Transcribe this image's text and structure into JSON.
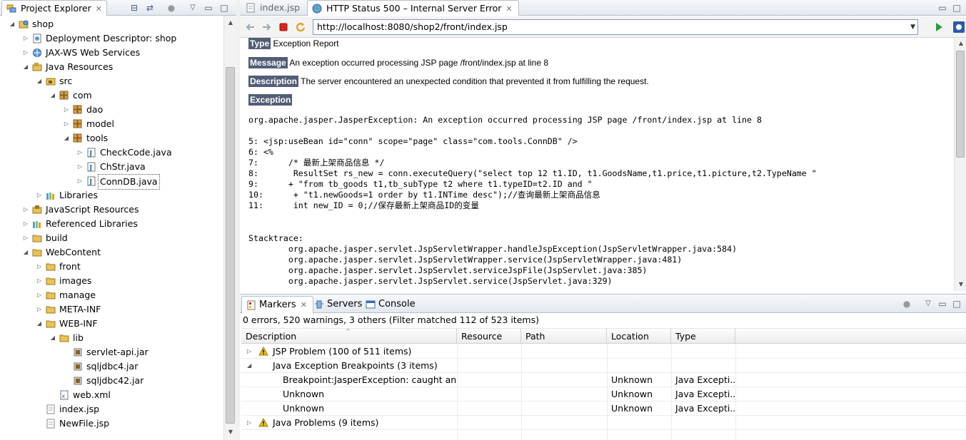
{
  "explorer": {
    "tab_label": "Project Explorer",
    "tree": [
      {
        "label": "shop",
        "icon": "project-icon",
        "depth": 0,
        "expanded": true
      },
      {
        "label": "Deployment Descriptor: shop",
        "icon": "deployment-descriptor-icon",
        "depth": 1,
        "expanded": false
      },
      {
        "label": "JAX-WS Web Services",
        "icon": "web-services-icon",
        "depth": 1,
        "expanded": false
      },
      {
        "label": "Java Resources",
        "icon": "java-resources-icon",
        "depth": 1,
        "expanded": true
      },
      {
        "label": "src",
        "icon": "source-folder-icon",
        "depth": 2,
        "expanded": true
      },
      {
        "label": "com",
        "icon": "package-icon",
        "depth": 3,
        "expanded": true
      },
      {
        "label": "dao",
        "icon": "package-icon",
        "depth": 4,
        "expanded": false
      },
      {
        "label": "model",
        "icon": "package-icon",
        "depth": 4,
        "expanded": false
      },
      {
        "label": "tools",
        "icon": "package-icon",
        "depth": 4,
        "expanded": true
      },
      {
        "label": "CheckCode.java",
        "icon": "java-file-icon",
        "depth": 5,
        "expanded": false
      },
      {
        "label": "ChStr.java",
        "icon": "java-file-icon",
        "depth": 5,
        "expanded": false
      },
      {
        "label": "ConnDB.java",
        "icon": "java-file-icon",
        "depth": 5,
        "expanded": false,
        "selected": true
      },
      {
        "label": "Libraries",
        "icon": "library-icon",
        "depth": 2,
        "expanded": false
      },
      {
        "label": "JavaScript Resources",
        "icon": "javascript-resources-icon",
        "depth": 1,
        "expanded": false
      },
      {
        "label": "Referenced Libraries",
        "icon": "library-icon",
        "depth": 1,
        "expanded": false
      },
      {
        "label": "build",
        "icon": "folder-icon",
        "depth": 1,
        "expanded": false
      },
      {
        "label": "WebContent",
        "icon": "folder-icon",
        "depth": 1,
        "expanded": true
      },
      {
        "label": "front",
        "icon": "folder-icon",
        "depth": 2,
        "expanded": false
      },
      {
        "label": "images",
        "icon": "folder-icon",
        "depth": 2,
        "expanded": false
      },
      {
        "label": "manage",
        "icon": "folder-icon",
        "depth": 2,
        "expanded": false
      },
      {
        "label": "META-INF",
        "icon": "folder-icon",
        "depth": 2,
        "expanded": false
      },
      {
        "label": "WEB-INF",
        "icon": "folder-icon",
        "depth": 2,
        "expanded": true
      },
      {
        "label": "lib",
        "icon": "folder-icon",
        "depth": 3,
        "expanded": true
      },
      {
        "label": "servlet-api.jar",
        "icon": "jar-file-icon",
        "depth": 4,
        "leaf": true
      },
      {
        "label": "sqljdbc4.jar",
        "icon": "jar-file-icon",
        "depth": 4,
        "leaf": true
      },
      {
        "label": "sqljdbc42.jar",
        "icon": "jar-file-icon",
        "depth": 4,
        "leaf": true
      },
      {
        "label": "web.xml",
        "icon": "xml-file-icon",
        "depth": 3,
        "leaf": true
      },
      {
        "label": "index.jsp",
        "icon": "jsp-file-icon",
        "depth": 2,
        "leaf": true
      },
      {
        "label": "NewFile.jsp",
        "icon": "jsp-file-icon",
        "depth": 2,
        "leaf": true
      }
    ]
  },
  "editor": {
    "tabs": [
      {
        "label": "index.jsp",
        "active": false
      },
      {
        "label": "HTTP Status 500 – Internal Server Error",
        "active": true
      }
    ],
    "url": "http://localhost:8080/shop2/front/index.jsp",
    "page": {
      "type_label": "Type",
      "type_value": "Exception Report",
      "message_label": "Message",
      "message_value": "An exception occurred processing JSP page /front/index.jsp at line 8",
      "description_label": "Description",
      "description_value": "The server encountered an unexpected condition that prevented it from fulfilling the request.",
      "exception_label": "Exception",
      "exception_line": "org.apache.jasper.JasperException: An exception occurred processing JSP page /front/index.jsp at line 8",
      "code_lines": [
        "5: <jsp:useBean id=\"conn\" scope=\"page\" class=\"com.tools.ConnDB\" />",
        "6: <%",
        "7:      /* 最新上架商品信息 */",
        "8:       ResultSet rs_new = conn.executeQuery(\"select top 12 t1.ID, t1.GoodsName,t1.price,t1.picture,t2.TypeName \"",
        "9:      + \"from tb_goods t1,tb_subType t2 where t1.typeID=t2.ID and \"",
        "10:      + \"t1.newGoods=1 order by t1.INTime desc\");//查询最新上架商品信息",
        "11:      int new_ID = 0;//保存最新上架商品ID的变量"
      ],
      "stacktrace_label": "Stacktrace:",
      "stack_lines": [
        "        org.apache.jasper.servlet.JspServletWrapper.handleJspException(JspServletWrapper.java:584)",
        "        org.apache.jasper.servlet.JspServletWrapper.service(JspServletWrapper.java:481)",
        "        org.apache.jasper.servlet.JspServlet.serviceJspFile(JspServlet.java:385)",
        "        org.apache.jasper.servlet.JspServlet.service(JspServlet.java:329)"
      ]
    }
  },
  "markers": {
    "tabs": [
      {
        "label": "Markers",
        "icon": "markers-icon",
        "active": true
      },
      {
        "label": "Servers",
        "icon": "servers-icon",
        "active": false
      },
      {
        "label": "Console",
        "icon": "console-icon",
        "active": false
      }
    ],
    "summary": "0 errors, 520 warnings, 3 others (Filter matched 112 of 523 items)",
    "columns": [
      "Description",
      "Resource",
      "Path",
      "Location",
      "Type"
    ],
    "rows": [
      {
        "kind": "group",
        "expanded": false,
        "warning": true,
        "description": "JSP Problem (100 of 511 items)",
        "resource": "",
        "path": "",
        "location": "",
        "type": ""
      },
      {
        "kind": "group",
        "expanded": true,
        "warning": false,
        "description": "Java Exception Breakpoints (3 items)",
        "resource": "",
        "path": "",
        "location": "",
        "type": ""
      },
      {
        "kind": "item",
        "description": "Breakpoint:JasperException: caught and",
        "resource": "",
        "path": "",
        "location": "Unknown",
        "type": "Java Excepti..."
      },
      {
        "kind": "item",
        "description": "Unknown",
        "resource": "",
        "path": "",
        "location": "Unknown",
        "type": "Java Excepti..."
      },
      {
        "kind": "item",
        "description": "Unknown",
        "resource": "",
        "path": "",
        "location": "Unknown",
        "type": "Java Excepti..."
      },
      {
        "kind": "group",
        "expanded": false,
        "warning": true,
        "description": "Java Problems (9 items)",
        "resource": "",
        "path": "",
        "location": "",
        "type": ""
      }
    ]
  },
  "colors": {
    "http_label_bg": "#525d76",
    "warning_yellow": "#f0c020",
    "run_green": "#2e9b3a",
    "stop_red": "#d9261c"
  }
}
